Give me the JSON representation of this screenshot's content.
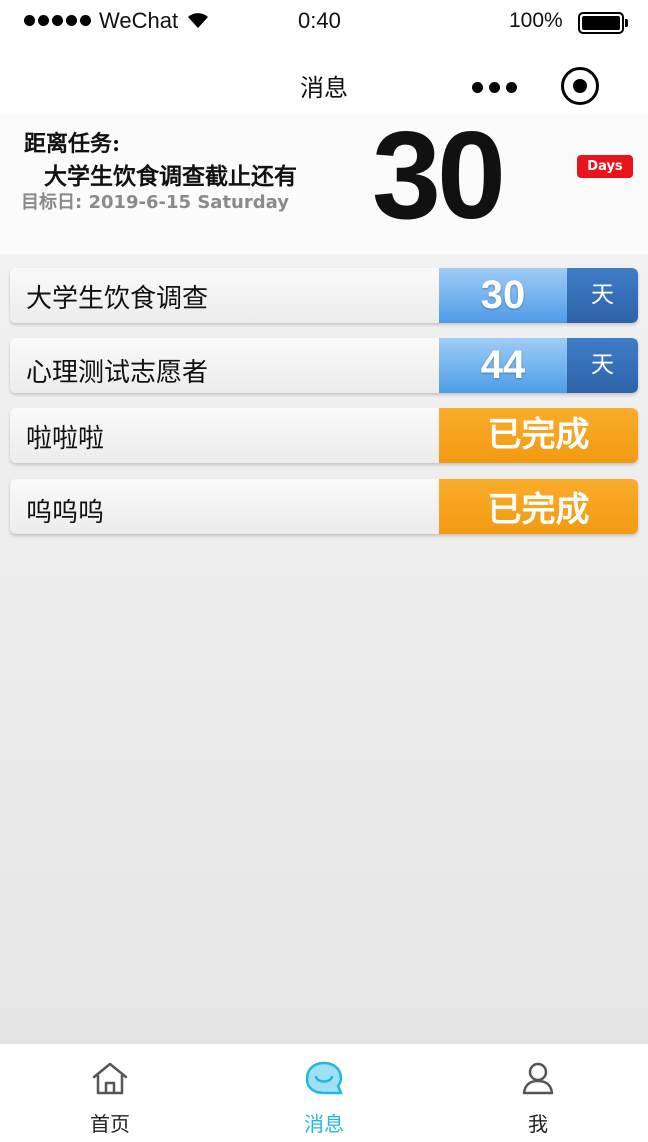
{
  "status_bar": {
    "carrier": "WeChat",
    "time": "0:40",
    "battery": "100%"
  },
  "nav": {
    "title": "消息"
  },
  "countdown": {
    "label": "距离任务:",
    "task": "大学生饮食调查截止还有",
    "target_date": "目标日: 2019-6-15 Saturday",
    "days": "30",
    "unit_badge": "Days"
  },
  "tasks": [
    {
      "name": "大学生饮食调查",
      "count": "30",
      "unit": "天"
    },
    {
      "name": "心理测试志愿者",
      "count": "44",
      "unit": "天"
    },
    {
      "name": "啦啦啦",
      "status": "已完成"
    },
    {
      "name": "呜呜呜",
      "status": "已完成"
    }
  ],
  "tab_bar": {
    "items": [
      {
        "label": "首页",
        "icon": "home-icon"
      },
      {
        "label": "消息",
        "icon": "message-icon",
        "active": true
      },
      {
        "label": "我",
        "icon": "user-icon"
      }
    ],
    "active_color": "#20b8e0"
  },
  "colors": {
    "count_blue": "#4e9ce8",
    "unit_blue": "#2d63a9",
    "done_orange": "#f39a12",
    "badge_red": "#e8141b"
  }
}
